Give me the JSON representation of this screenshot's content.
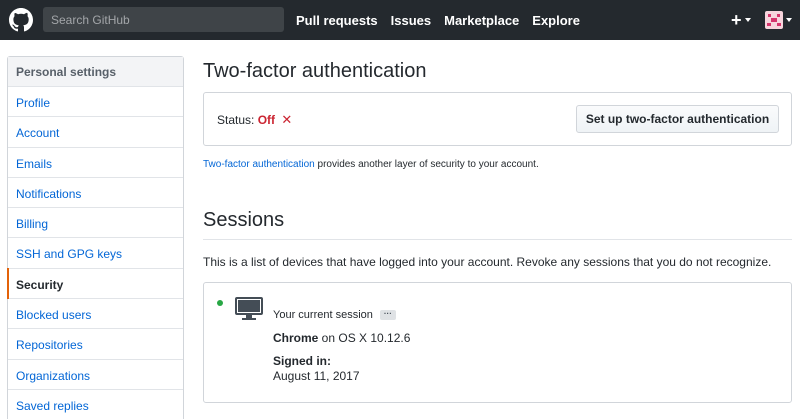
{
  "header": {
    "search_placeholder": "Search GitHub",
    "nav": [
      "Pull requests",
      "Issues",
      "Marketplace",
      "Explore"
    ],
    "plus_label": "+",
    "icons": {
      "logo": "github-octocat-icon",
      "plus": "plus-icon",
      "avatar": "user-avatar"
    }
  },
  "sidebar": {
    "heading": "Personal settings",
    "items": [
      {
        "label": "Profile"
      },
      {
        "label": "Account"
      },
      {
        "label": "Emails"
      },
      {
        "label": "Notifications"
      },
      {
        "label": "Billing"
      },
      {
        "label": "SSH and GPG keys"
      },
      {
        "label": "Security"
      },
      {
        "label": "Blocked users"
      },
      {
        "label": "Repositories"
      },
      {
        "label": "Organizations"
      },
      {
        "label": "Saved replies"
      }
    ],
    "selected_index": 6
  },
  "two_factor": {
    "title": "Two-factor authentication",
    "status_label": "Status:",
    "status_value": "Off",
    "status_mark": "✕",
    "setup_button": "Set up two-factor authentication",
    "note_link": "Two-factor authentication",
    "note_text": " provides another layer of security to your account."
  },
  "sessions": {
    "title": "Sessions",
    "description": "This is a list of devices that have logged into your account. Revoke any sessions that you do not recognize.",
    "current": {
      "label": "Your current session",
      "ellipsis": "···",
      "browser": "Chrome",
      "os_text": " on OS X 10.12.6",
      "signed_in_label": "Signed in:",
      "signed_in_date": "August 11, 2017",
      "icon": "desktop-computer-icon"
    }
  },
  "colors": {
    "header_bg": "#24292e",
    "link": "#0366d6",
    "danger": "#cb2431",
    "active_session": "#28a745",
    "selected_border": "#e36209"
  }
}
